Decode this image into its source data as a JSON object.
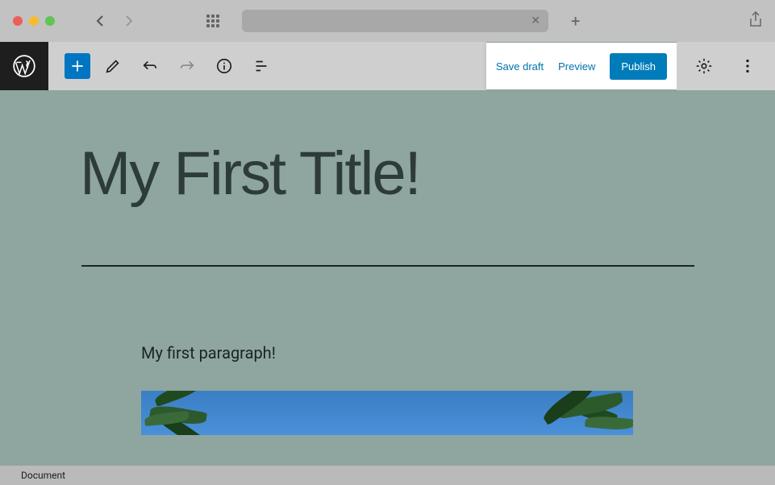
{
  "toolbar": {
    "save_draft": "Save draft",
    "preview": "Preview",
    "publish": "Publish"
  },
  "post": {
    "title": "My First Title!",
    "paragraph": "My first paragraph!"
  },
  "footer": {
    "breadcrumb": "Document"
  },
  "icons": {
    "wp_logo": "wordpress-logo",
    "add": "plus-icon",
    "edit": "pencil-icon",
    "undo": "undo-icon",
    "redo": "redo-icon",
    "info": "info-icon",
    "outline": "list-icon",
    "settings": "gear-icon",
    "more": "kebab-icon"
  }
}
